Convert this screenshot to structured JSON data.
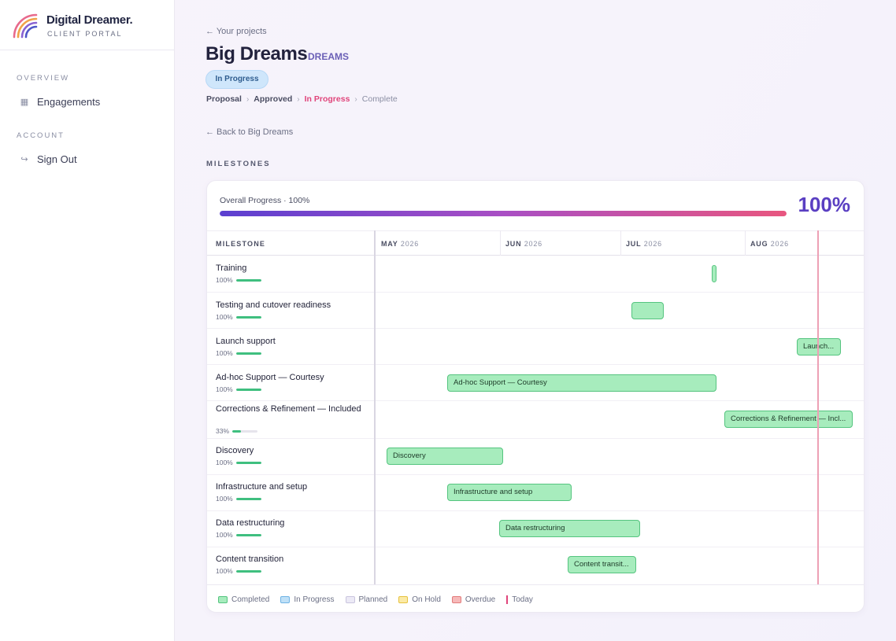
{
  "brand": {
    "name": "Digital Dreamer.",
    "sub": "CLIENT PORTAL"
  },
  "sidebar": {
    "sections": [
      {
        "label": "OVERVIEW",
        "items": [
          {
            "label": "Engagements",
            "icon": "grid-icon"
          }
        ]
      },
      {
        "label": "ACCOUNT",
        "items": [
          {
            "label": "Sign Out",
            "icon": "sign-out-icon"
          }
        ]
      }
    ]
  },
  "header": {
    "back_projects": "← Your projects",
    "title": "Big Dreams",
    "code": "DREAMS",
    "status": "In Progress",
    "steps": [
      "Proposal",
      "Approved",
      "In Progress",
      "Complete"
    ],
    "step_separator": "›",
    "back_project": "← Back to Big Dreams",
    "section": "MILESTONES"
  },
  "progress": {
    "label": "Overall Progress · 100%",
    "value": 100,
    "display": "100%"
  },
  "gantt": {
    "column_title": "MILESTONE",
    "months": [
      {
        "month": "MAY",
        "year": "2026"
      },
      {
        "month": "JUN",
        "year": "2026"
      },
      {
        "month": "JUL",
        "year": "2026"
      },
      {
        "month": "AUG",
        "year": "2026"
      }
    ],
    "rows": [
      {
        "name": "Training",
        "pct_label": "100%",
        "pct": 1.0,
        "bar_label": "",
        "status": "completed"
      },
      {
        "name": "Testing and cutover readiness",
        "pct_label": "100%",
        "pct": 1.0,
        "bar_label": "",
        "status": "completed"
      },
      {
        "name": "Launch support",
        "pct_label": "100%",
        "pct": 1.0,
        "bar_label": "Launch...",
        "status": "completed"
      },
      {
        "name": "Ad-hoc Support — Courtesy",
        "pct_label": "100%",
        "pct": 1.0,
        "bar_label": "Ad-hoc Support — Courtesy",
        "status": "completed"
      },
      {
        "name": "Corrections & Refinement — Included",
        "pct_label": "33%",
        "pct": 0.33,
        "bar_label": "Corrections & Refinement — Incl...",
        "status": "completed"
      },
      {
        "name": "Discovery",
        "pct_label": "100%",
        "pct": 1.0,
        "bar_label": "Discovery",
        "status": "completed"
      },
      {
        "name": "Infrastructure and setup",
        "pct_label": "100%",
        "pct": 1.0,
        "bar_label": "Infrastructure and setup",
        "status": "completed"
      },
      {
        "name": "Data restructuring",
        "pct_label": "100%",
        "pct": 1.0,
        "bar_label": "Data restructuring",
        "status": "completed"
      },
      {
        "name": "Content transition",
        "pct_label": "100%",
        "pct": 1.0,
        "bar_label": "Content transit...",
        "status": "completed"
      }
    ]
  },
  "legend": [
    {
      "label": "Completed",
      "fill": "#a7ecbd",
      "border": "#55c47f"
    },
    {
      "label": "In Progress",
      "fill": "#bfe0f7",
      "border": "#6fb2e4"
    },
    {
      "label": "Planned",
      "fill": "#eceaf6",
      "border": "#c9c5de"
    },
    {
      "label": "On Hold",
      "fill": "#fbeaa6",
      "border": "#e6c23f"
    },
    {
      "label": "Overdue",
      "fill": "#f6b9b9",
      "border": "#e27b7b"
    },
    {
      "label": "Today",
      "color": "#e0457b"
    }
  ],
  "colors": {
    "accent": "#5a3fc2",
    "active_step": "#e0457b",
    "completed": "#a7ecbd"
  }
}
